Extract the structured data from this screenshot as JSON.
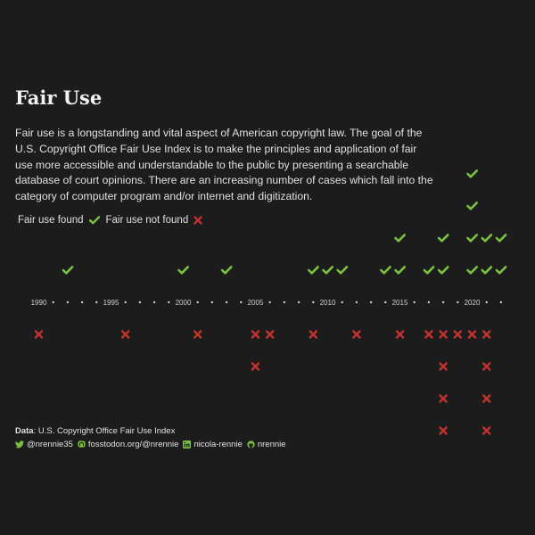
{
  "title": "Fair Use",
  "subtitle": "Fair use is a longstanding and vital aspect of American copyright law. The goal of the U.S. Copyright Office Fair Use Index is to make the principles and application of fair use more accessible and understandable to the public by presenting a searchable database of court opinions. There are an increasing number of cases which fall into the category of computer program and/or internet and digitization.",
  "legend": {
    "found_label": "Fair use found",
    "not_found_label": "Fair use not found"
  },
  "colors": {
    "background": "#1c1c1c",
    "found": "#7cc043",
    "not_found": "#c0322d",
    "text": "#e0e0e0",
    "axis": "#cfcfcf"
  },
  "caption": {
    "data_label": "Data",
    "data_text": ": U.S. Copyright Office Fair Use Index",
    "social": [
      {
        "icon": "twitter-icon",
        "text": "@nrennie35"
      },
      {
        "icon": "mastodon-icon",
        "text": "fosstodon.org/@nrennie"
      },
      {
        "icon": "linkedin-icon",
        "text": "nicola-rennie"
      },
      {
        "icon": "github-icon",
        "text": "nrennie"
      }
    ]
  },
  "chart_data": {
    "type": "scatter",
    "x_range": [
      1990,
      2022
    ],
    "tick_labels": [
      "1990",
      "1995",
      "2000",
      "2005",
      "2010",
      "2015",
      "2020"
    ],
    "series": [
      {
        "name": "Fair use found",
        "symbol": "check",
        "counts": {
          "1992": 1,
          "2000": 1,
          "2003": 1,
          "2009": 1,
          "2010": 1,
          "2011": 1,
          "2014": 1,
          "2015": 2,
          "2017": 1,
          "2018": 2,
          "2020": 4,
          "2021": 2,
          "2022": 2
        }
      },
      {
        "name": "Fair use not found",
        "symbol": "cross",
        "counts": {
          "1990": 1,
          "1996": 1,
          "2001": 1,
          "2005": 2,
          "2006": 1,
          "2009": 1,
          "2012": 1,
          "2015": 1,
          "2017": 1,
          "2018": 4,
          "2019": 1,
          "2020": 1,
          "2021": 4
        }
      }
    ]
  }
}
